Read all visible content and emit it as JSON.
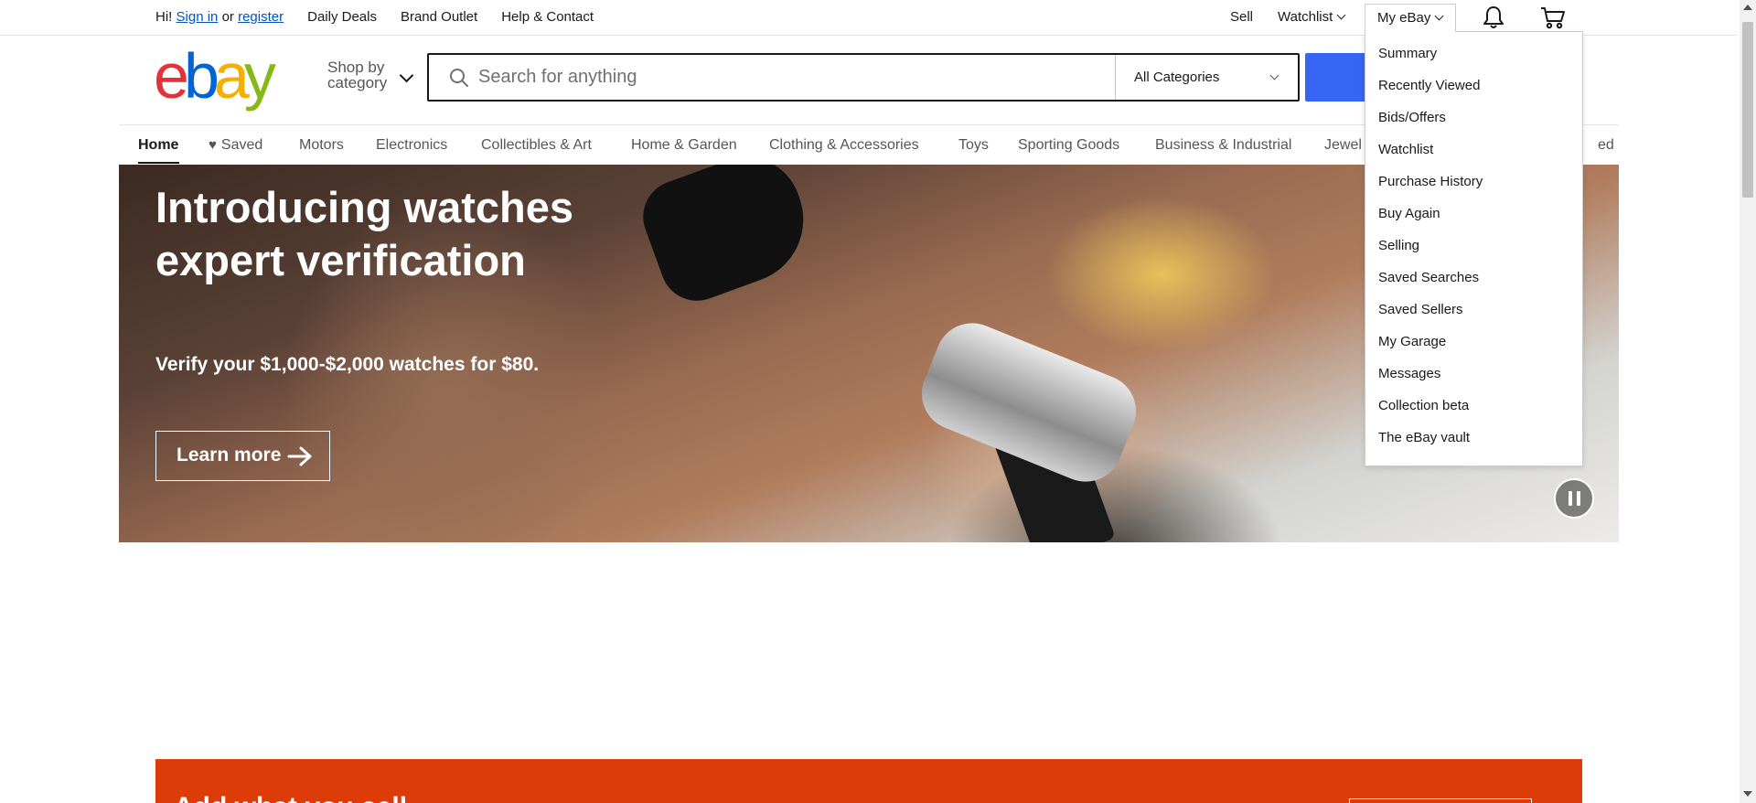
{
  "topbar": {
    "greeting": "Hi!",
    "sign_in": "Sign in",
    "or": "or",
    "register": "register",
    "daily_deals": "Daily Deals",
    "brand_outlet": "Brand Outlet",
    "help_contact": "Help & Contact",
    "sell": "Sell",
    "watchlist": "Watchlist",
    "my_ebay": "My eBay"
  },
  "icons": {
    "bell": "bell-icon",
    "cart": "cart-icon",
    "search": "search-icon"
  },
  "logo": {
    "letters": [
      "e",
      "b",
      "a",
      "y"
    ],
    "colors": [
      "#e53238",
      "#0064d2",
      "#f5af02",
      "#86b817"
    ]
  },
  "header": {
    "shop_by_line1": "Shop by",
    "shop_by_line2": "category",
    "search_placeholder": "Search for anything",
    "category_selected": "All Categories",
    "search_button_color": "#3665f3"
  },
  "catnav": {
    "items": [
      "Home",
      "Saved",
      "Motors",
      "Electronics",
      "Collectibles & Art",
      "Home & Garden",
      "Clothing & Accessories",
      "Toys",
      "Sporting Goods",
      "Business & Industrial",
      "Jewelry & Watches",
      "Refurbished"
    ],
    "visible_fragments": {
      "jewelry": "Jewel",
      "refurbished": "ed"
    }
  },
  "hero": {
    "title": "Introducing watches expert verification",
    "subtitle": "Verify your $1,000-$2,000 watches for $80.",
    "button": "Learn more"
  },
  "myebay_menu": {
    "items": [
      "Summary",
      "Recently Viewed",
      "Bids/Offers",
      "Watchlist",
      "Purchase History",
      "Buy Again",
      "Selling",
      "Saved Searches",
      "Saved Sellers",
      "My Garage",
      "Messages",
      "Collection beta",
      "The eBay vault"
    ]
  },
  "promo": {
    "title": "Add what you sell",
    "color": "#dd3b08"
  }
}
